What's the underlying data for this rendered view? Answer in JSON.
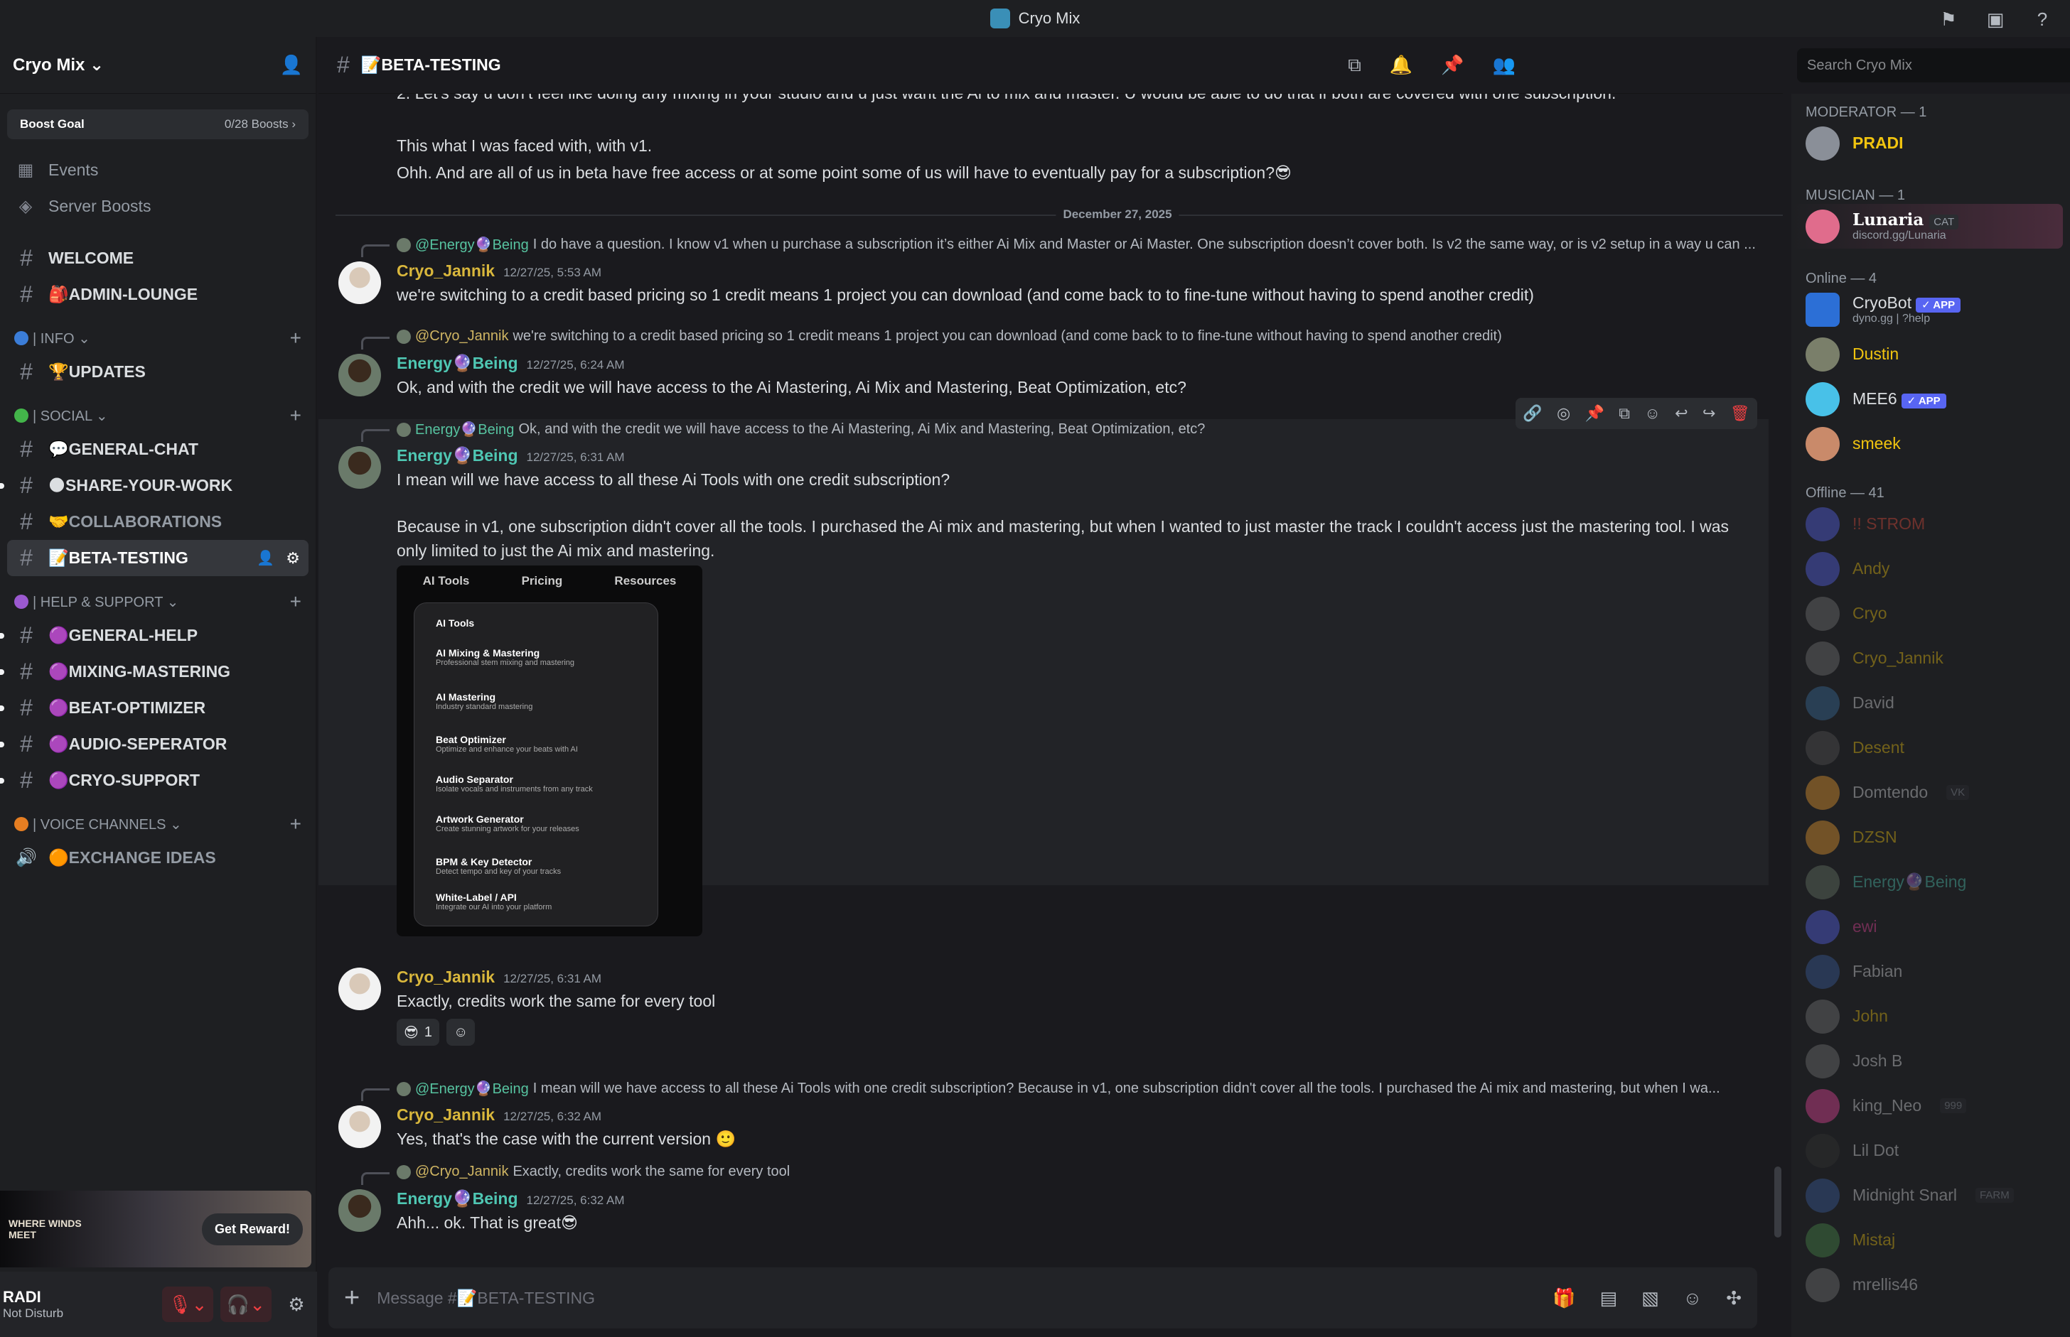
{
  "window": {
    "title": "Cryo Mix"
  },
  "server": {
    "name": "Cryo Mix",
    "boost_label": "Boost Goal",
    "boost_count": "0/28 Boosts"
  },
  "nav": [
    {
      "label": "Events",
      "icon": "calendar-icon"
    },
    {
      "label": "Server Boosts",
      "icon": "boost-icon"
    }
  ],
  "channels_top": [
    {
      "label": "WELCOME"
    },
    {
      "label": "🎒ADMIN-LOUNGE"
    }
  ],
  "cat_info": "| INFO",
  "channels_info": [
    {
      "label": "🏆UPDATES"
    }
  ],
  "cat_social": "| SOCIAL",
  "channels_social": [
    {
      "label": "💬GENERAL-CHAT"
    },
    {
      "label": "🌑SHARE-YOUR-WORK"
    },
    {
      "label": "🤝COLLABORATIONS"
    },
    {
      "label": "📝BETA-TESTING"
    }
  ],
  "cat_help": "| HELP & SUPPORT",
  "channels_help": [
    {
      "label": "🟣GENERAL-HELP"
    },
    {
      "label": "🟣MIXING-MASTERING"
    },
    {
      "label": "🟣BEAT-OPTIMIZER"
    },
    {
      "label": "🟣AUDIO-SEPERATOR"
    },
    {
      "label": "🟣CRYO-SUPPORT"
    }
  ],
  "cat_voice": "| VOICE CHANNELS",
  "channels_voice": [
    {
      "label": "🟠EXCHANGE IDEAS"
    }
  ],
  "promo": {
    "brand": "WHERE WINDS MEET",
    "button": "Get Reward!"
  },
  "user": {
    "name": "RADI",
    "status": "Not Disturb"
  },
  "chat": {
    "channel": "📝BETA-TESTING",
    "search_placeholder": "Search Cryo Mix",
    "composer_placeholder": "Message #📝BETA-TESTING",
    "date_divider": "December 27, 2025",
    "top_lines": [
      "2. Let’s say u don’t feel like doing any mixing in your studio and u just want the Ai to mix and master. U would be able to do that if both are covered with one subscription.",
      "This what I was faced with, with v1.",
      "Ohh. And are all of us in beta have free access or at some point some of us will have to eventually pay for a subscription?😎"
    ],
    "messages": [
      {
        "reply_name": "@Energy🔮Being",
        "reply_text": "I do have a question. I know v1 when u purchase a subscription it’s either Ai Mix and Master or Ai Master. One subscription doesn’t cover both.  Is v2 the same way, or is v2 setup in a way u can ...",
        "author": "Cryo_Jannik",
        "time": "12/27/25, 5:53 AM",
        "text": "we're switching to a credit based pricing so 1 credit means 1 project you can download (and come back to to fine-tune without having to spend another credit)"
      },
      {
        "reply_name": "@Cryo_Jannik",
        "reply_text": "we're switching to a credit based pricing so 1 credit means 1 project you can download (and come back to to fine-tune without having to spend another credit)",
        "author": "Energy🔮Being",
        "time": "12/27/25, 6:24 AM",
        "text": "Ok, and with the credit we will have access to the Ai Mastering, Ai Mix and Mastering, Beat Optimization, etc?"
      },
      {
        "reply_name": "Energy🔮Being",
        "reply_text": "Ok, and with the credit we will have access to the Ai Mastering, Ai Mix and Mastering, Beat Optimization, etc?",
        "author": "Energy🔮Being",
        "time": "12/27/25, 6:31 AM",
        "text": "I mean will we have access to all these Ai Tools with one credit subscription?",
        "text2": "Because in v1, one subscription didn't cover all the tools. I purchased the Ai mix and mastering, but when I wanted to just master the track I couldn't access just the mastering tool. I was",
        "text3": "only limited to just the Ai mix and mastering."
      },
      {
        "author": "Cryo_Jannik",
        "time": "12/27/25, 6:31 AM",
        "text": "Exactly, credits work the same for every tool",
        "reaction_emoji": "😎",
        "reaction_count": "1"
      },
      {
        "reply_name": "@Energy🔮Being",
        "reply_text": "I mean will we have access to all these Ai Tools with one credit subscription?  Because in v1, one subscription didn't cover all the tools. I purchased the Ai mix and mastering, but when I wa...",
        "author": "Cryo_Jannik",
        "time": "12/27/25, 6:32 AM",
        "text": "Yes, that's the case with the current version 🙂"
      },
      {
        "reply_name": "@Cryo_Jannik",
        "reply_text": "Exactly, credits work the same for every tool",
        "author": "Energy🔮Being",
        "time": "12/27/25, 6:32 AM",
        "text": "Ahh... ok. That is great😎"
      }
    ],
    "attachment": {
      "nav": [
        "AI Tools",
        "Pricing",
        "Resources"
      ],
      "menu_title": "AI Tools",
      "items": [
        {
          "t": "AI Mixing & Mastering",
          "s": "Professional stem mixing and mastering"
        },
        {
          "t": "AI Mastering",
          "s": "Industry standard mastering"
        },
        {
          "t": "Beat Optimizer",
          "s": "Optimize and enhance your beats with AI"
        },
        {
          "t": "Audio Separator",
          "s": "Isolate vocals and instruments from any track"
        },
        {
          "t": "Artwork Generator",
          "s": "Create stunning artwork for your releases"
        },
        {
          "t": "BPM & Key Detector",
          "s": "Detect tempo and key of your tracks"
        },
        {
          "t": "White-Label / API",
          "s": "Integrate our AI into your platform"
        }
      ]
    }
  },
  "members": {
    "moderator_cat": "MODERATOR — 1",
    "moderator": "PRADI",
    "musician_cat": "MUSICIAN — 1",
    "musician": "Lunaria",
    "musician_tag": "CAT",
    "musician_sub": "discord.gg/Lunaria",
    "online_cat": "Online — 4",
    "online": [
      {
        "name": "CryoBot",
        "badge": "✓ APP",
        "sub": "dyno.gg | ?help"
      },
      {
        "name": "Dustin"
      },
      {
        "name": "MEE6",
        "badge": "✓ APP"
      },
      {
        "name": "smeek"
      }
    ],
    "offline_cat": "Offline — 41",
    "offline": [
      {
        "name": "!! STROM"
      },
      {
        "name": "Andy"
      },
      {
        "name": "Cryo"
      },
      {
        "name": "Cryo_Jannik"
      },
      {
        "name": "David"
      },
      {
        "name": "Desent"
      },
      {
        "name": "Domtendo",
        "tag": "VK"
      },
      {
        "name": "DZSN"
      },
      {
        "name": "Energy🔮Being"
      },
      {
        "name": "ewi"
      },
      {
        "name": "Fabian"
      },
      {
        "name": "John"
      },
      {
        "name": "Josh B"
      },
      {
        "name": "king_Neo",
        "tag": "999"
      },
      {
        "name": "Lil Dot"
      },
      {
        "name": "Midnight Snarl",
        "tag": "FARM"
      },
      {
        "name": "Mistaj"
      },
      {
        "name": "mrellis46"
      }
    ]
  }
}
